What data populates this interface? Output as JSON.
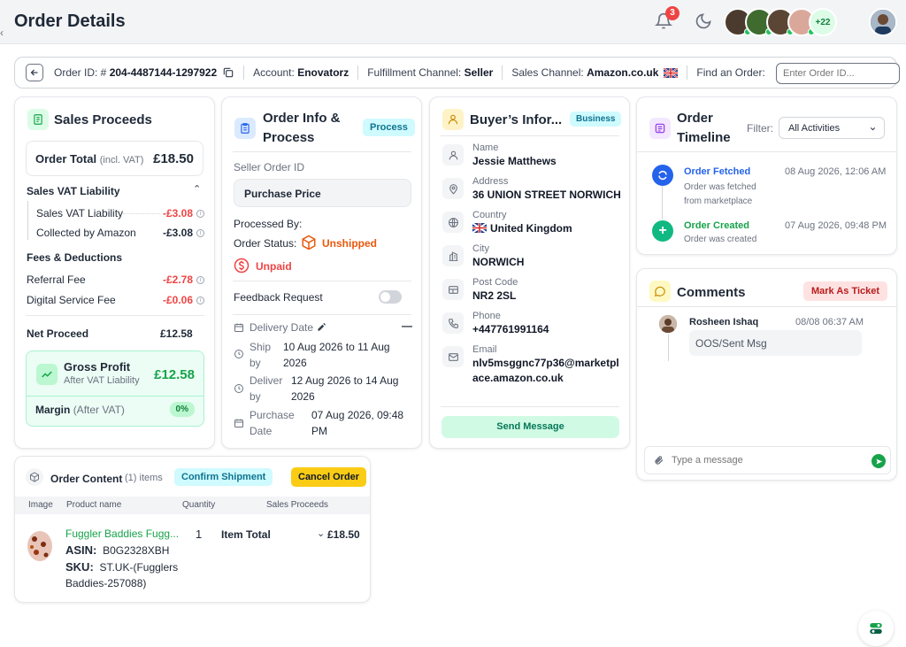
{
  "header": {
    "title": "Order Details",
    "notifications_count": "3",
    "avatars_more": "+22"
  },
  "idbar": {
    "order_id_label": "Order ID: #",
    "order_id": "204-4487144-1297922",
    "account_label": "Account:",
    "account": "Enovatorz",
    "fulfillment_label": "Fulfillment Channel:",
    "fulfillment": "Seller",
    "sales_channel_label": "Sales Channel:",
    "sales_channel": "Amazon.co.uk",
    "find_label": "Find an Order:",
    "find_placeholder": "Enter Order ID..."
  },
  "sales": {
    "title": "Sales Proceeds",
    "order_total_label": "Order Total",
    "order_total_note": "(incl. VAT)",
    "order_total": "£18.50",
    "vat_section": "Sales VAT Liability",
    "vat_rows": [
      {
        "label": "Sales VAT Liability",
        "value": "-£3.08"
      },
      {
        "label": "Collected by Amazon",
        "value": "-£3.08"
      }
    ],
    "fees_section": "Fees & Deductions",
    "fee_rows": [
      {
        "label": "Referral Fee",
        "value": "-£2.78"
      },
      {
        "label": "Digital Service Fee",
        "value": "-£0.06"
      }
    ],
    "net_label": "Net Proceed",
    "net_value": "£12.58",
    "gross_label": "Gross Profit",
    "gross_sub": "After VAT Liability",
    "gross_value": "£12.58",
    "margin_label": "Margin",
    "margin_note": "(After VAT)",
    "margin_value": "0%"
  },
  "order_info": {
    "title_line1": "Order Info &",
    "title_line2": "Process",
    "badge": "Process",
    "seller_order_label": "Seller Order ID",
    "purchase_price": "Purchase Price",
    "processed_by": "Processed By:",
    "order_status_label": "Order Status:",
    "order_status": "Unshipped",
    "payment_status": "Unpaid",
    "feedback_label": "Feedback Request",
    "delivery_label": "Delivery Date",
    "ship_label": "Ship by",
    "ship_value": "10 Aug 2026 to 11 Aug 2026",
    "deliver_label": "Deliver by",
    "deliver_value": "12 Aug 2026 to 14 Aug 2026",
    "purchase_label": "Purchase Date",
    "purchase_value": "07 Aug 2026, 09:48 PM"
  },
  "buyer": {
    "title": "Buyer’s Infor...",
    "badge": "Business",
    "name_label": "Name",
    "name": "Jessie Matthews",
    "address_label": "Address",
    "address": "36 UNION STREET NORWICH",
    "country_label": "Country",
    "country": "United Kingdom",
    "city_label": "City",
    "city": "NORWICH",
    "postcode_label": "Post Code",
    "postcode": "NR2 2SL",
    "phone_label": "Phone",
    "phone": "+447761991164",
    "email_label": "Email",
    "email": "nlv5msggnc77p36@marketplace.amazon.co.uk",
    "send_button": "Send Message"
  },
  "timeline": {
    "title_line1": "Order",
    "title_line2": "Timeline",
    "filter_label": "Filter:",
    "filter_value": "All Activities",
    "events": [
      {
        "title": "Order Fetched",
        "desc": "Order was fetched from marketplace",
        "time": "08 Aug 2026, 12:06 AM"
      },
      {
        "title": "Order Created",
        "desc": "Order was created",
        "time": "07 Aug 2026, 09:48 PM"
      }
    ]
  },
  "comments": {
    "title": "Comments",
    "ticket_button": "Mark As Ticket",
    "author": "Rosheen Ishaq",
    "time": "08/08 06:37 AM",
    "message": "OOS/Sent Msg",
    "input_placeholder": "Type a message"
  },
  "content": {
    "title": "Order Content",
    "count": "(1) items",
    "confirm_button": "Confirm Shipment",
    "cancel_button": "Cancel Order",
    "columns": [
      "Image",
      "Product name",
      "Quantity",
      "Sales Proceeds"
    ],
    "product_name": "Fuggler Baddies Fugg...",
    "asin_label": "ASIN:",
    "asin": "B0G2328XBH",
    "sku_label": "SKU:",
    "sku": "ST.UK-(Fugglers Baddies-257088)",
    "quantity": "1",
    "item_total_label": "Item Total",
    "item_total": "£18.50"
  },
  "colors": {
    "green": "#16a34a",
    "red": "#ef4444",
    "orange": "#ea580c",
    "blue": "#2563eb",
    "yellow": "#facc15"
  }
}
